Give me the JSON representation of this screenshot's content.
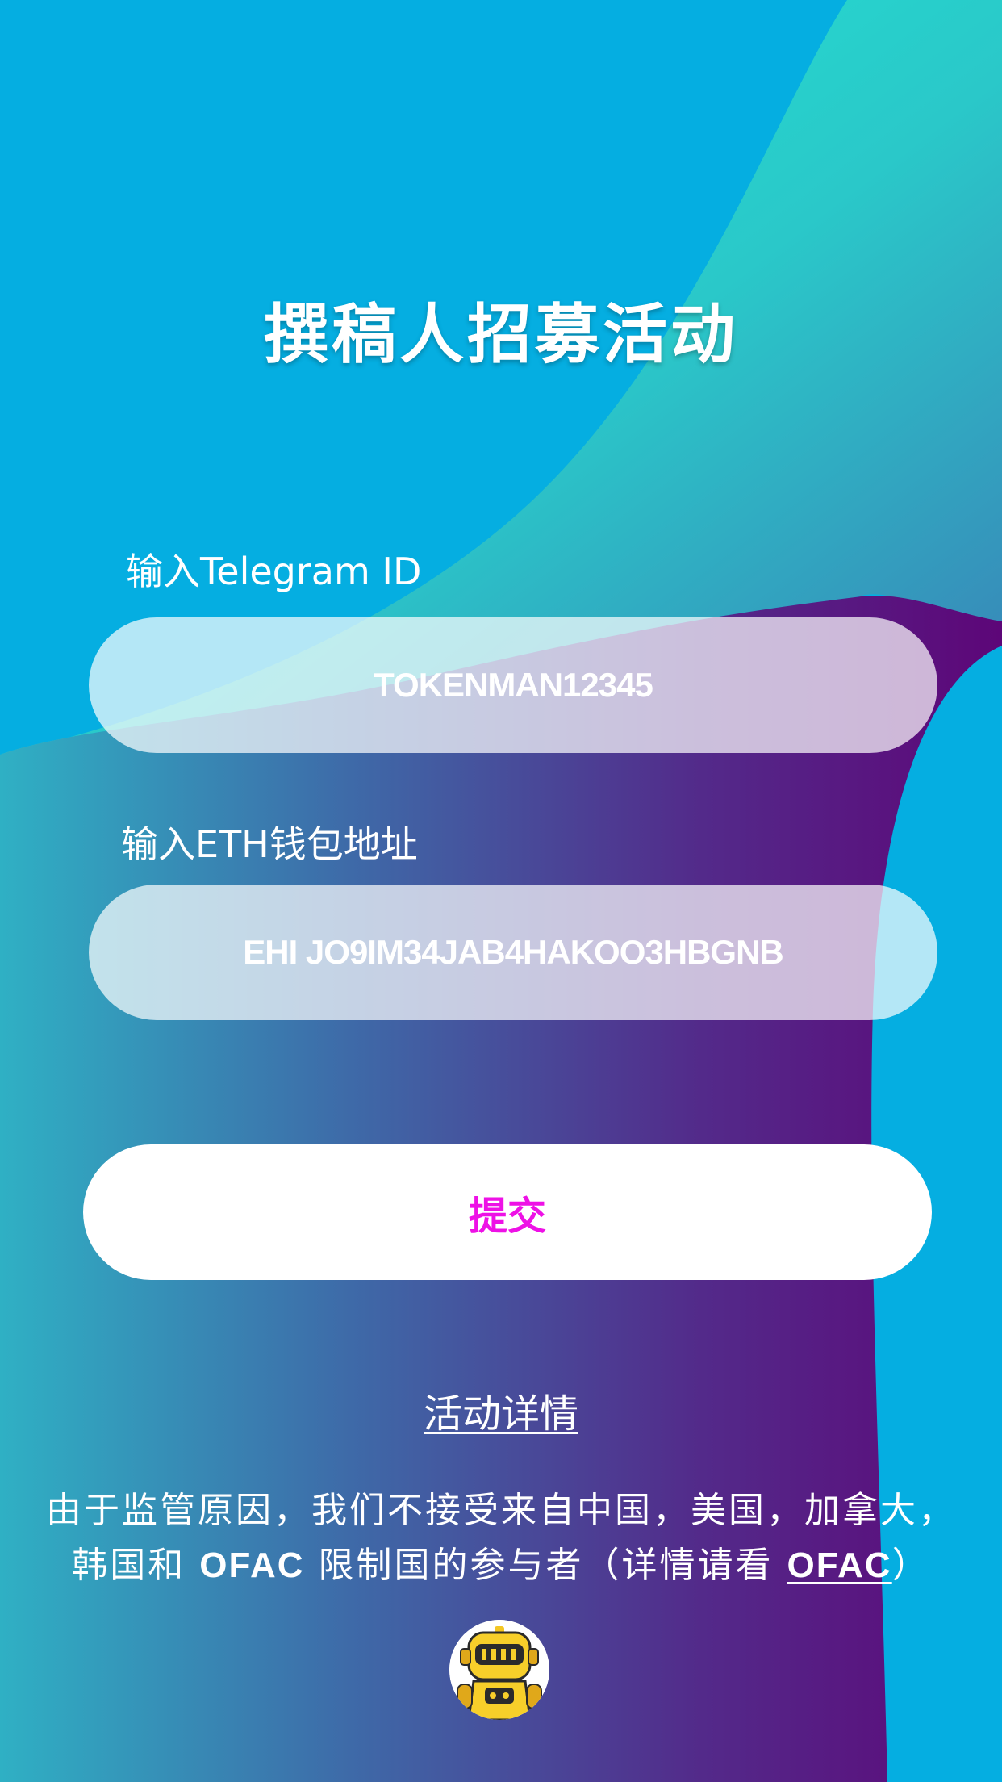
{
  "page": {
    "title": "撰稿人招募活动"
  },
  "form": {
    "telegram_label": "输入Telegram ID",
    "telegram_value": "TOKENMAN12345",
    "eth_label": "输入ETH钱包地址",
    "eth_value": "EHI JO9IM34JAB4HAKOO3HBGNB",
    "submit_label": "提交"
  },
  "details": {
    "link_label": "活动详情"
  },
  "notice": {
    "line1": "由于监管原因，我们不接受来自中国，美国，加拿大，",
    "line2_prefix": "韩国和 ",
    "line2_ofac": "OFAC",
    "line2_middle": " 限制国的参与者（详情请看 ",
    "line2_link": "OFAC",
    "line2_suffix": "）"
  },
  "colors": {
    "background_blue": "#05aee1",
    "teal": "#18e6d0",
    "purple": "#5a0d7d",
    "submit_text": "#ee11e6"
  },
  "icons": {
    "avatar": "robot-mascot-icon"
  }
}
